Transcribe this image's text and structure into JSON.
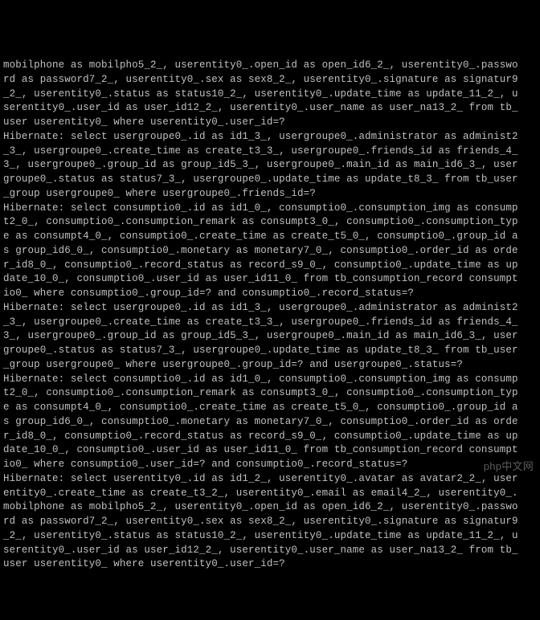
{
  "terminal": {
    "lines": [
      "mobilphone as mobilpho5_2_, userentity0_.open_id as open_id6_2_, userentity0_.passwo",
      "rd as password7_2_, userentity0_.sex as sex8_2_, userentity0_.signature as signatur9",
      "_2_, userentity0_.status as status10_2_, userentity0_.update_time as update_11_2_, u",
      "serentity0_.user_id as user_id12_2_, userentity0_.user_name as user_na13_2_ from tb_",
      "user userentity0_ where userentity0_.user_id=?",
      "Hibernate: select usergroupe0_.id as id1_3_, usergroupe0_.administrator as administ2",
      "_3_, usergroupe0_.create_time as create_t3_3_, usergroupe0_.friends_id as friends_4_",
      "3_, usergroupe0_.group_id as group_id5_3_, usergroupe0_.main_id as main_id6_3_, user",
      "groupe0_.status as status7_3_, usergroupe0_.update_time as update_t8_3_ from tb_user",
      "_group usergroupe0_ where usergroupe0_.friends_id=?",
      "Hibernate: select consumptio0_.id as id1_0_, consumptio0_.consumption_img as consump",
      "t2_0_, consumptio0_.consumption_remark as consumpt3_0_, consumptio0_.consumption_typ",
      "e as consumpt4_0_, consumptio0_.create_time as create_t5_0_, consumptio0_.group_id a",
      "s group_id6_0_, consumptio0_.monetary as monetary7_0_, consumptio0_.order_id as orde",
      "r_id8_0_, consumptio0_.record_status as record_s9_0_, consumptio0_.update_time as up",
      "date_10_0_, consumptio0_.user_id as user_id11_0_ from tb_consumption_record consumpt",
      "io0_ where consumptio0_.group_id=? and consumptio0_.record_status=?",
      "Hibernate: select usergroupe0_.id as id1_3_, usergroupe0_.administrator as administ2",
      "_3_, usergroupe0_.create_time as create_t3_3_, usergroupe0_.friends_id as friends_4_",
      "3_, usergroupe0_.group_id as group_id5_3_, usergroupe0_.main_id as main_id6_3_, user",
      "groupe0_.status as status7_3_, usergroupe0_.update_time as update_t8_3_ from tb_user",
      "_group usergroupe0_ where usergroupe0_.group_id=? and usergroupe0_.status=?",
      "Hibernate: select consumptio0_.id as id1_0_, consumptio0_.consumption_img as consump",
      "t2_0_, consumptio0_.consumption_remark as consumpt3_0_, consumptio0_.consumption_typ",
      "e as consumpt4_0_, consumptio0_.create_time as create_t5_0_, consumptio0_.group_id a",
      "s group_id6_0_, consumptio0_.monetary as monetary7_0_, consumptio0_.order_id as orde",
      "r_id8_0_, consumptio0_.record_status as record_s9_0_, consumptio0_.update_time as up",
      "date_10_0_, consumptio0_.user_id as user_id11_0_ from tb_consumption_record consumpt",
      "io0_ where consumptio0_.user_id=? and consumptio0_.record_status=?",
      "Hibernate: select userentity0_.id as id1_2_, userentity0_.avatar as avatar2_2_, user",
      "entity0_.create_time as create_t3_2_, userentity0_.email as email4_2_, userentity0_.",
      "mobilphone as mobilpho5_2_, userentity0_.open_id as open_id6_2_, userentity0_.passwo",
      "rd as password7_2_, userentity0_.sex as sex8_2_, userentity0_.signature as signatur9",
      "_2_, userentity0_.status as status10_2_, userentity0_.update_time as update_11_2_, u",
      "serentity0_.user_id as user_id12_2_, userentity0_.user_name as user_na13_2_ from tb_",
      "user userentity0_ where userentity0_.user_id=?"
    ]
  },
  "watermark": "php中文网"
}
